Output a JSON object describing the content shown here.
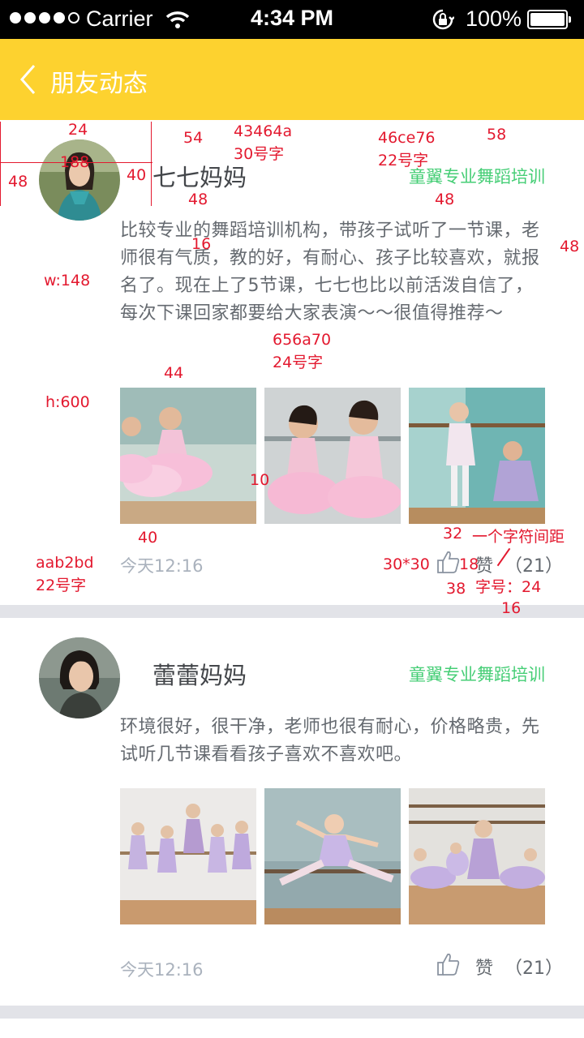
{
  "status_bar": {
    "carrier": "Carrier",
    "time": "4:34 PM",
    "battery": "100%",
    "icons": [
      "signal-icon",
      "wifi-icon",
      "orientation-lock-icon",
      "battery-icon"
    ]
  },
  "nav": {
    "back_icon": "chevron-left-icon",
    "title": "朋友动态"
  },
  "colors": {
    "nav_bg": "#fdd22f",
    "username": "#43464a",
    "org": "#46ce76",
    "content": "#656a70",
    "time": "#aab2bd",
    "annotation": "#e3192f"
  },
  "posts": [
    {
      "username": "七七妈妈",
      "org": "童翼专业舞蹈培训",
      "content": "比较专业的舞蹈培训机构，带孩子试听了一节课，老师很有气质，教的好，有耐心、孩子比较喜欢，就报名了。现在上了5节课，七七也比以前活泼自信了，每次下课回家都要给大家表演～～很值得推荐～",
      "time": "今天12:16",
      "like_label": "赞",
      "like_count": "（21）"
    },
    {
      "username": "蕾蕾妈妈",
      "org": "童翼专业舞蹈培训",
      "content": "环境很好，很干净，老师也很有耐心，价格略贵，先试听几节课看看孩子喜欢不喜欢吧。",
      "time": "今天12:16",
      "like_label": "赞",
      "like_count": "（21）"
    }
  ],
  "annotations": {
    "a1": "24",
    "a2": "54",
    "a3": "43464a",
    "a4": "30号字",
    "a5": "46ce76",
    "a6": "22号字",
    "a7": "58",
    "a8": "188",
    "a9": "48",
    "a10": "40",
    "a11": "48",
    "a12": "48",
    "a13": "16",
    "a14": "48",
    "a15": "w:148",
    "a16": "656a70",
    "a17": "24号字",
    "a18": "44",
    "a19": "h:600",
    "a20": "10",
    "a21": "40",
    "a22": "32",
    "a23": "一个字符间距",
    "a24": "aab2bd",
    "a25": "22号字",
    "a26": "30*30",
    "a27": "18",
    "a28": "38",
    "a29": "字号：24",
    "a30": "16"
  }
}
